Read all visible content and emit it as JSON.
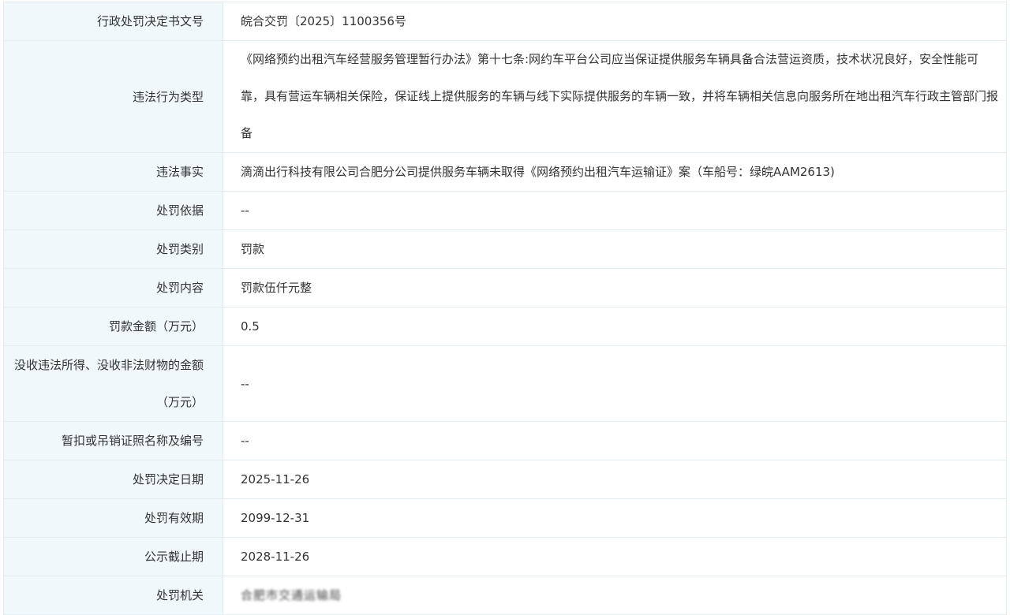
{
  "rows": [
    {
      "label": "行政处罚决定书文号",
      "value": "皖合交罚〔2025〕1100356号"
    },
    {
      "label": "违法行为类型",
      "value": "《网络预约出租汽车经营服务管理暂行办法》第十七条:网约车平台公司应当保证提供服务车辆具备合法营运资质，技术状况良好，安全性能可靠，具有营运车辆相关保险，保证线上提供服务的车辆与线下实际提供服务的车辆一致，并将车辆相关信息向服务所在地出租汽车行政主管部门报备"
    },
    {
      "label": "违法事实",
      "value": "滴滴出行科技有限公司合肥分公司提供服务车辆未取得《网络预约出租汽车运输证》案（车船号：绿皖AAM2613)"
    },
    {
      "label": "处罚依据",
      "value": "--"
    },
    {
      "label": "处罚类别",
      "value": "罚款"
    },
    {
      "label": "处罚内容",
      "value": "罚款伍仟元整"
    },
    {
      "label": "罚款金额（万元）",
      "value": "0.5"
    },
    {
      "label": "没收违法所得、没收非法财物的金额（万元）",
      "value": "--"
    },
    {
      "label": "暂扣或吊销证照名称及编号",
      "value": "--"
    },
    {
      "label": "处罚决定日期",
      "value": "2025-11-26"
    },
    {
      "label": "处罚有效期",
      "value": "2099-12-31"
    },
    {
      "label": "公示截止期",
      "value": "2028-11-26"
    },
    {
      "label": "处罚机关",
      "value": "合肥市交通运输局"
    }
  ]
}
